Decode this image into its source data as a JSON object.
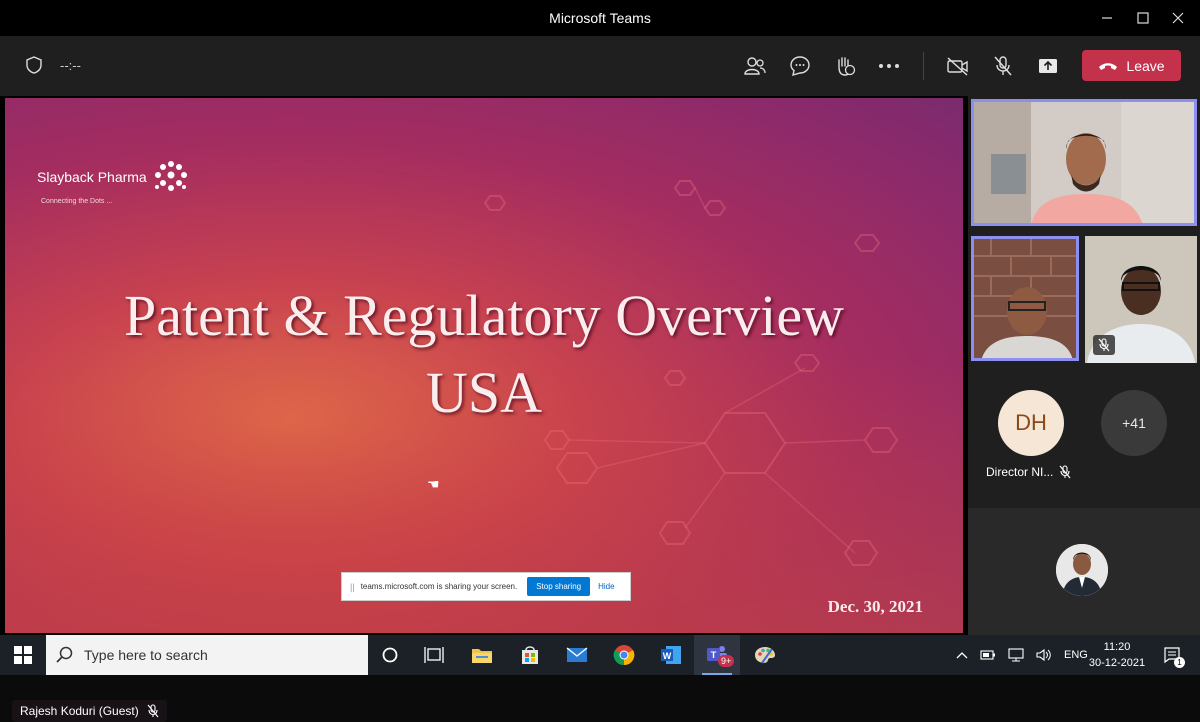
{
  "window": {
    "title": "Microsoft Teams"
  },
  "toolbar": {
    "timer": "--:--",
    "leave_label": "Leave",
    "accent_leave": "#c4314b"
  },
  "slide": {
    "brand_name": "Slayback Pharma",
    "brand_tagline": "Connecting the Dots ...",
    "title_line1": "Patent & Regulatory Overview",
    "title_line2": "USA",
    "date": "Dec. 30, 2021"
  },
  "share_banner": {
    "message": "teams.microsoft.com is sharing your screen.",
    "stop_label": "Stop sharing",
    "hide_label": "Hide"
  },
  "presenter": {
    "name": "Rajesh Koduri (Guest)"
  },
  "participants": {
    "dh_initials": "DH",
    "dh_name": "Director NI...",
    "overflow_count": "+41"
  },
  "taskbar": {
    "search_placeholder": "Type here to search",
    "teams_badge": "9+",
    "language": "ENG",
    "time": "11:20",
    "date": "30-12-2021",
    "notification_count": "1"
  }
}
